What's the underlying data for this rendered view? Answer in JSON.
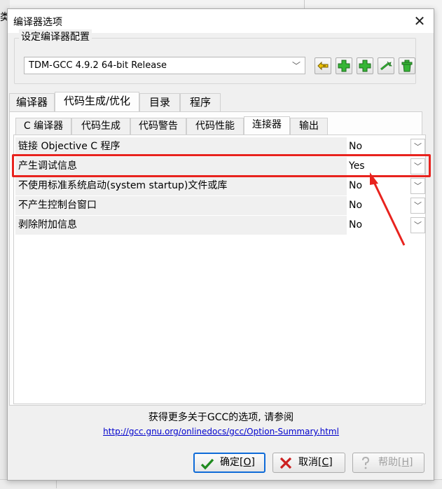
{
  "background": {
    "left_text": "类"
  },
  "dialog": {
    "title": "编译器选项",
    "close_glyph": "✕"
  },
  "config": {
    "group_title": "设定编译器配置",
    "selected_compiler": "TDM-GCC 4.9.2 64-bit Release",
    "dropdown_glyph": "﹀",
    "toolbar": [
      {
        "name": "rename-config-button",
        "icon": "rename-icon",
        "color": "#d9b400"
      },
      {
        "name": "add-config-button",
        "icon": "plus-icon",
        "color": "#2eaa2e"
      },
      {
        "name": "add-from-folder-button",
        "icon": "plus-icon",
        "color": "#2eaa2e"
      },
      {
        "name": "find-compilers-button",
        "icon": "wand-icon",
        "color": "#2eaa2e"
      },
      {
        "name": "delete-config-button",
        "icon": "trash-icon",
        "color": "#2eaa2e"
      }
    ]
  },
  "tabs": [
    "编译器",
    "代码生成/优化",
    "目录",
    "程序"
  ],
  "active_tab": "代码生成/优化",
  "subtabs": [
    "C 编译器",
    "代码生成",
    "代码警告",
    "代码性能",
    "连接器",
    "输出"
  ],
  "active_subtab": "连接器",
  "options": [
    {
      "label": "链接 Objective C 程序",
      "value": "No"
    },
    {
      "label": "产生调试信息",
      "value": "Yes"
    },
    {
      "label": "不使用标准系统启动(system startup)文件或库",
      "value": "No"
    },
    {
      "label": "不产生控制台窗口",
      "value": "No"
    },
    {
      "label": "剥除附加信息",
      "value": "No"
    }
  ],
  "row_dropdown_glyph": "﹀",
  "highlight_color": "#e8231e",
  "footer": {
    "info": "获得更多关于GCC的选项, 请参阅",
    "link": "http://gcc.gnu.org/onlinedocs/gcc/Option-Summary.html"
  },
  "buttons": {
    "ok": {
      "text": "确定[",
      "key": "O",
      "end": "]"
    },
    "cancel": {
      "text": "取消[",
      "key": "C",
      "end": "]"
    },
    "help": {
      "text": "帮助[",
      "key": "H",
      "end": "]"
    }
  }
}
